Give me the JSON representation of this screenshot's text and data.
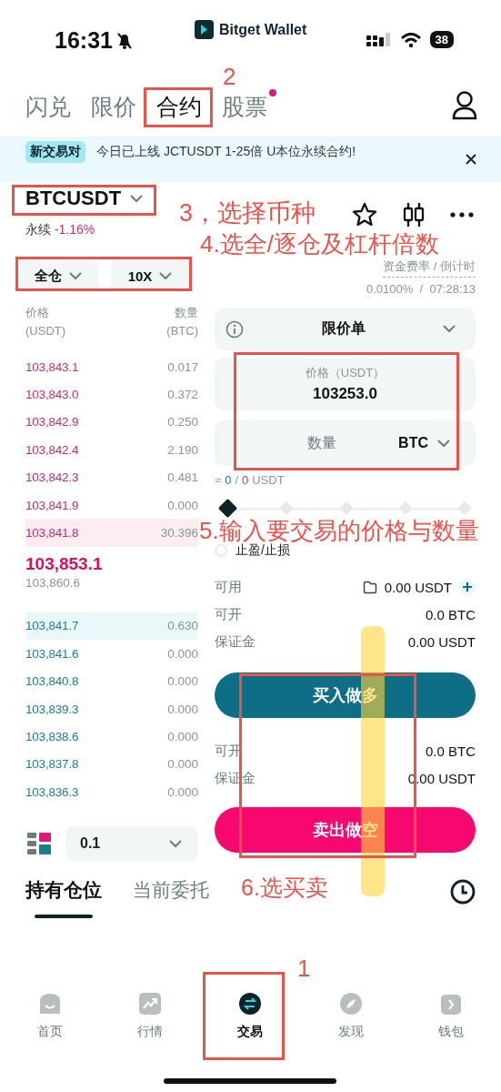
{
  "status_bar": {
    "time": "16:31",
    "app": "Bitget Wallet",
    "battery": "38"
  },
  "top_tabs": [
    {
      "label": "闪兑",
      "selected": false,
      "badge": false
    },
    {
      "label": "限价",
      "selected": false,
      "badge": false
    },
    {
      "label": "合约",
      "selected": true,
      "badge": false
    },
    {
      "label": "股票",
      "selected": false,
      "badge": true
    }
  ],
  "banner": {
    "tag": "新交易对",
    "text": "今日已上线 JCTUSDT 1-25倍 U本位永续合约!"
  },
  "symbol": {
    "name": "BTCUSDT",
    "type": "永续",
    "change": "-1.16%"
  },
  "margin": {
    "mode": "全仓",
    "leverage": "10X"
  },
  "funding": {
    "label": "资金费率 / 倒计时",
    "value": "0.0100%  /  07:28:13"
  },
  "order_book": {
    "columns": [
      {
        "title": "价格",
        "unit": "(USDT)"
      },
      {
        "title": "数量",
        "unit": "(BTC)"
      }
    ],
    "asks": [
      {
        "price": "103,843.1",
        "amount": "0.017",
        "highlighted": false
      },
      {
        "price": "103,843.0",
        "amount": "0.372",
        "highlighted": false
      },
      {
        "price": "103,842.9",
        "amount": "0.250",
        "highlighted": false
      },
      {
        "price": "103,842.4",
        "amount": "2.190",
        "highlighted": false
      },
      {
        "price": "103,842.3",
        "amount": "0.481",
        "highlighted": false
      },
      {
        "price": "103,841.9",
        "amount": "0.000",
        "highlighted": false
      },
      {
        "price": "103,841.8",
        "amount": "30.396",
        "highlighted": true
      }
    ],
    "last_price": "103,853.1",
    "mark_price": "103,860.6",
    "bids": [
      {
        "price": "103,841.7",
        "amount": "0.630",
        "highlighted": true
      },
      {
        "price": "103,841.6",
        "amount": "0.000",
        "highlighted": false
      },
      {
        "price": "103,840.8",
        "amount": "0.000",
        "highlighted": false
      },
      {
        "price": "103,839.3",
        "amount": "0.000",
        "highlighted": false
      },
      {
        "price": "103,838.6",
        "amount": "0.000",
        "highlighted": false
      },
      {
        "price": "103,837.8",
        "amount": "0.000",
        "highlighted": false
      },
      {
        "price": "103,836.3",
        "amount": "0.000",
        "highlighted": false
      }
    ],
    "precision": "0.1"
  },
  "order_form": {
    "order_type": "限价单",
    "price_label": "价格（USDT）",
    "price": "103253.0",
    "quantity_placeholder": "数量",
    "quantity_unit": "BTC",
    "estimate": {
      "approx": "≈",
      "long": "0",
      "slash": "/",
      "short": "0",
      "unit": "USDT"
    },
    "amount_slider": {
      "level": 0
    },
    "tp_sl": {
      "label": "止盈/止损",
      "checked": false
    },
    "available": {
      "label": "可用",
      "value": "0.00 USDT"
    },
    "long": {
      "open_label": "可开",
      "open": "0.0 BTC",
      "margin_label": "保证金",
      "margin": "0.00 USDT",
      "button": "买入做多"
    },
    "short": {
      "open_label": "可开",
      "open": "0.0 BTC",
      "margin_label": "保证金",
      "margin": "0.00 USDT",
      "button": "卖出做空"
    }
  },
  "position_tabs": [
    {
      "label": "持有仓位",
      "selected": true
    },
    {
      "label": "当前委托",
      "selected": false
    }
  ],
  "nav": [
    {
      "label": "首页",
      "selected": false
    },
    {
      "label": "行情",
      "selected": false
    },
    {
      "label": "交易",
      "selected": true
    },
    {
      "label": "发现",
      "selected": false
    },
    {
      "label": "钱包",
      "selected": false
    }
  ],
  "annotations": [
    {
      "text": "2"
    },
    {
      "text": "3，选择币种"
    },
    {
      "text": "4.选全/逐仓及杠杆倍数"
    },
    {
      "text": "5.输入要交易的价格与数量"
    },
    {
      "text": "6.选买卖"
    },
    {
      "text": "1"
    }
  ]
}
